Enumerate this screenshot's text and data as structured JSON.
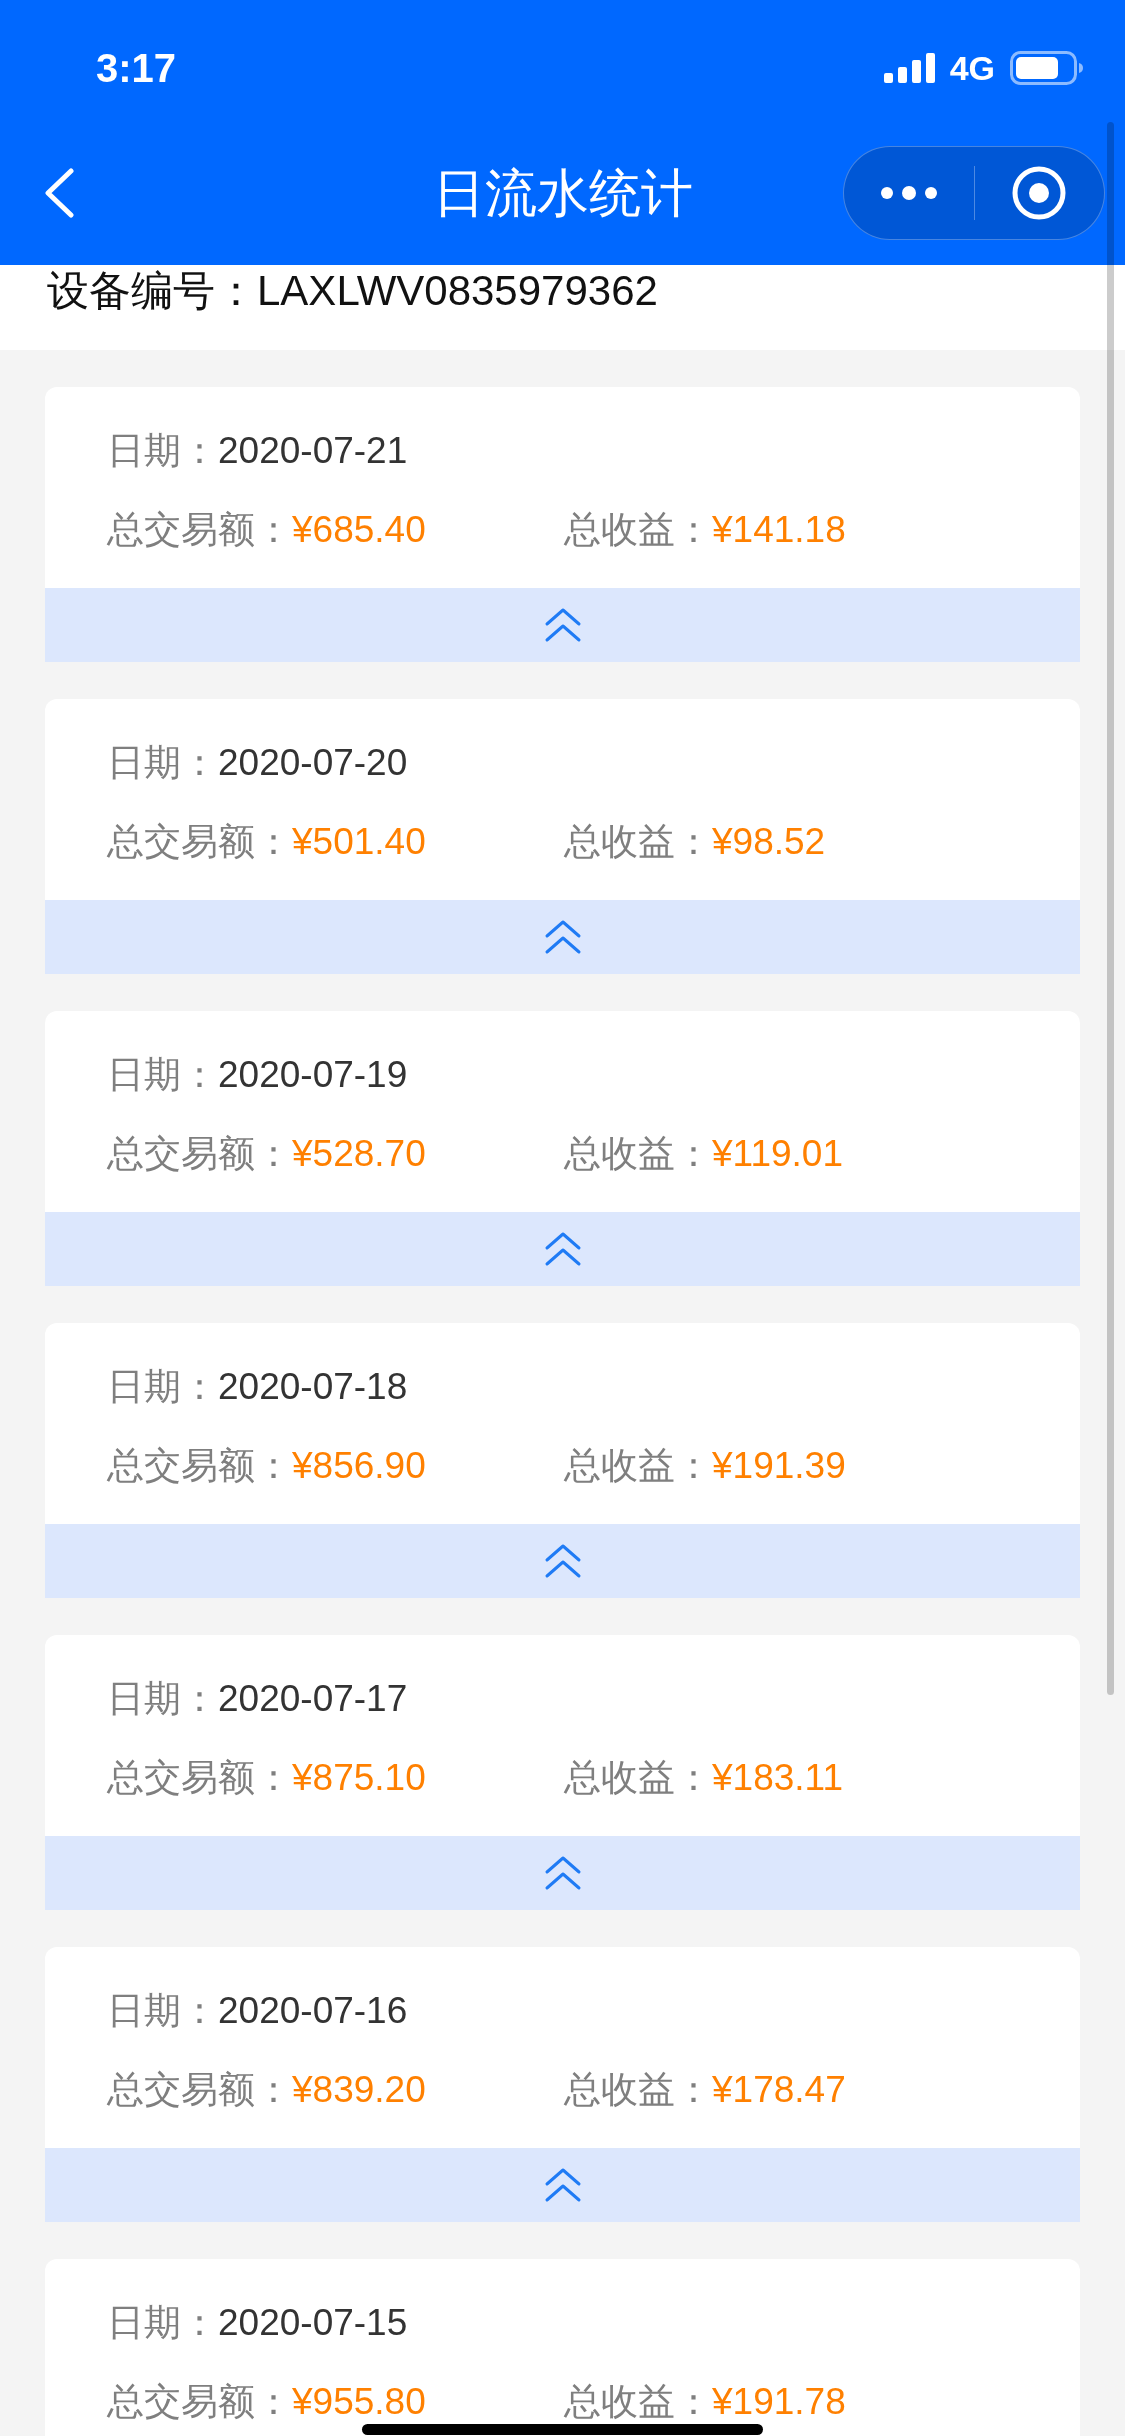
{
  "status_bar": {
    "time": "3:17",
    "network": "4G"
  },
  "nav_bar": {
    "title": "日流水统计"
  },
  "device": {
    "text": "设备编号：LAXLWV0835979362"
  },
  "records": [
    {
      "date_label": "日期：",
      "date": "2020-07-21",
      "total_label": "总交易额：",
      "total": "¥685.40",
      "income_label": "总收益：",
      "income": "¥141.18"
    },
    {
      "date_label": "日期：",
      "date": "2020-07-20",
      "total_label": "总交易额：",
      "total": "¥501.40",
      "income_label": "总收益：",
      "income": "¥98.52"
    },
    {
      "date_label": "日期：",
      "date": "2020-07-19",
      "total_label": "总交易额：",
      "total": "¥528.70",
      "income_label": "总收益：",
      "income": "¥119.01"
    },
    {
      "date_label": "日期：",
      "date": "2020-07-18",
      "total_label": "总交易额：",
      "total": "¥856.90",
      "income_label": "总收益：",
      "income": "¥191.39"
    },
    {
      "date_label": "日期：",
      "date": "2020-07-17",
      "total_label": "总交易额：",
      "total": "¥875.10",
      "income_label": "总收益：",
      "income": "¥183.11"
    },
    {
      "date_label": "日期：",
      "date": "2020-07-16",
      "total_label": "总交易额：",
      "total": "¥839.20",
      "income_label": "总收益：",
      "income": "¥178.47"
    },
    {
      "date_label": "日期：",
      "date": "2020-07-15",
      "total_label": "总交易额：",
      "total": "¥955.80",
      "income_label": "总收益：",
      "income": "¥191.78"
    }
  ]
}
